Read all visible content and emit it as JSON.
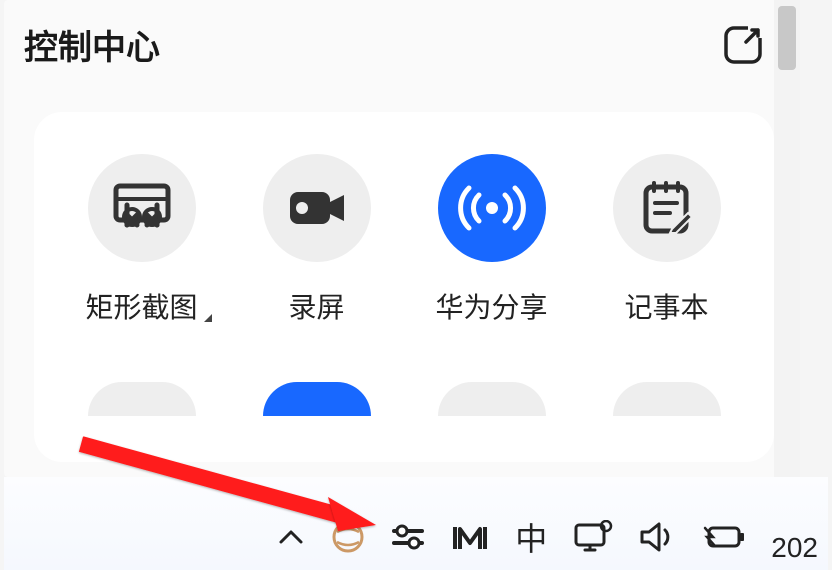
{
  "header": {
    "title": "控制中心"
  },
  "tiles": [
    {
      "label": "矩形截图",
      "active": false,
      "has_dropdown": true,
      "icon": "screenshot"
    },
    {
      "label": "录屏",
      "active": false,
      "has_dropdown": false,
      "icon": "record"
    },
    {
      "label": "华为分享",
      "active": true,
      "has_dropdown": false,
      "icon": "hotspot"
    },
    {
      "label": "记事本",
      "active": false,
      "has_dropdown": false,
      "icon": "notepad"
    }
  ],
  "row2": [
    {
      "active": false
    },
    {
      "active": true
    },
    {
      "active": false
    },
    {
      "active": false
    }
  ],
  "tray": {
    "ime": "中",
    "clock": "202"
  },
  "colors": {
    "accent": "#1868ff",
    "grey": "#eeeeee"
  }
}
